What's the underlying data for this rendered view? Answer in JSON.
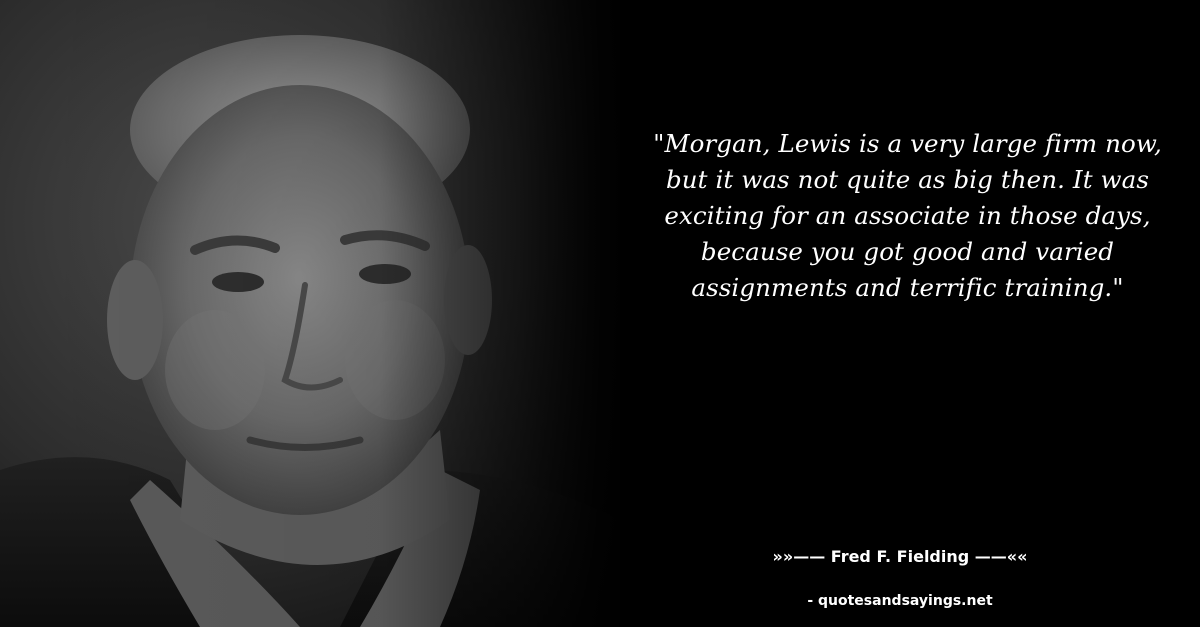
{
  "quote": {
    "text": "\"Morgan, Lewis is a very large firm now, but it was not quite as big then. It was exciting for an associate in those days, because you got good and varied assignments and terrific training.\""
  },
  "author": {
    "prefix": "»»—— ",
    "name": "Fred F. Fielding",
    "suffix": " ——««"
  },
  "source": {
    "text": "- quotesandsayings.net"
  },
  "colors": {
    "background": "#000000",
    "text": "#ffffff"
  }
}
